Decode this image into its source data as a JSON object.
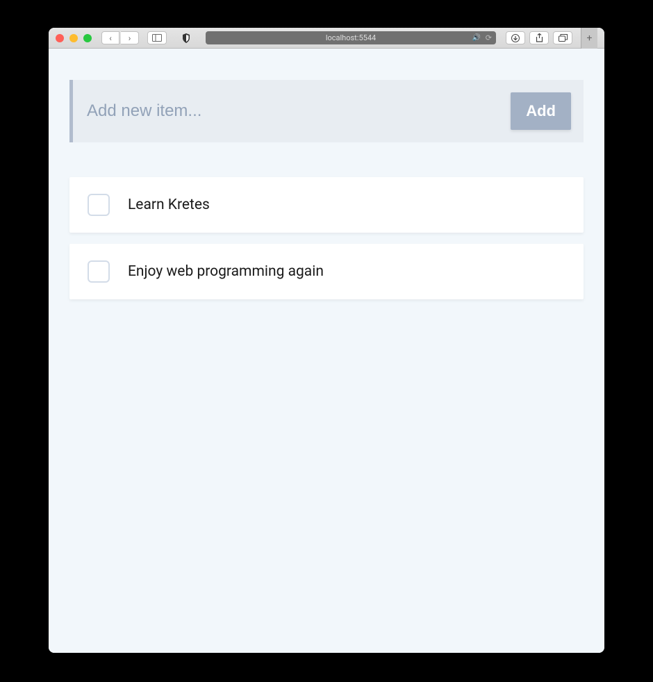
{
  "browser": {
    "url": "localhost:5544"
  },
  "addForm": {
    "placeholder": "Add new item...",
    "value": "",
    "buttonLabel": "Add"
  },
  "tasks": [
    {
      "text": "Learn Kretes",
      "checked": false
    },
    {
      "text": "Enjoy web programming again",
      "checked": false
    }
  ]
}
